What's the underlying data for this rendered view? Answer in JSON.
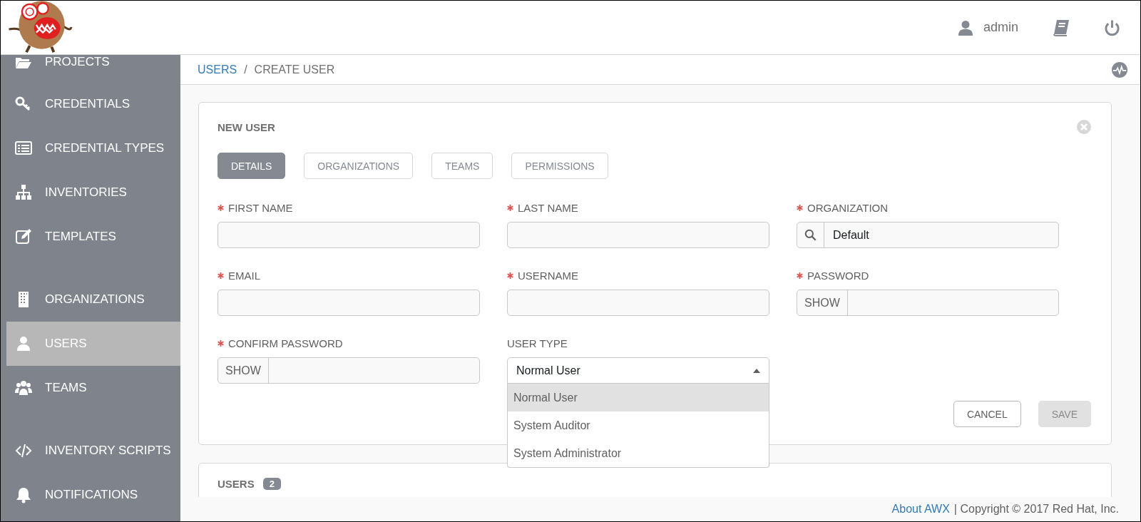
{
  "header": {
    "user": "admin"
  },
  "sidebar": {
    "groups": [
      [
        {
          "label": "PROJECTS",
          "selected": false
        },
        {
          "label": "CREDENTIALS",
          "selected": false
        },
        {
          "label": "CREDENTIAL TYPES",
          "selected": false
        },
        {
          "label": "INVENTORIES",
          "selected": false
        },
        {
          "label": "TEMPLATES",
          "selected": false
        }
      ],
      [
        {
          "label": "ORGANIZATIONS",
          "selected": false
        },
        {
          "label": "USERS",
          "selected": true
        },
        {
          "label": "TEAMS",
          "selected": false
        }
      ],
      [
        {
          "label": "INVENTORY SCRIPTS",
          "selected": false
        },
        {
          "label": "NOTIFICATIONS",
          "selected": false
        }
      ]
    ]
  },
  "breadcrumb": [
    {
      "label": "USERS",
      "link": true
    },
    {
      "label": "/",
      "link": false
    },
    {
      "label": "CREATE USER",
      "link": false
    }
  ],
  "form": {
    "title": "NEW USER",
    "tabs": [
      {
        "label": "DETAILS",
        "selected": true
      },
      {
        "label": "ORGANIZATIONS",
        "selected": false
      },
      {
        "label": "TEAMS",
        "selected": false
      },
      {
        "label": "PERMISSIONS",
        "selected": false
      }
    ],
    "fields": [
      {
        "kind": "text",
        "label": "FIRST NAME",
        "required": true
      },
      {
        "kind": "text",
        "label": "LAST NAME",
        "required": true
      },
      {
        "kind": "lookup",
        "label": "ORGANIZATION",
        "required": true,
        "value": "Default"
      },
      {
        "kind": "text",
        "label": "EMAIL",
        "required": true
      },
      {
        "kind": "text",
        "label": "USERNAME",
        "required": true
      },
      {
        "kind": "password",
        "label": "PASSWORD",
        "required": true,
        "button": "SHOW"
      },
      {
        "kind": "password",
        "label": "CONFIRM PASSWORD",
        "required": true,
        "button": "SHOW"
      },
      {
        "kind": "select",
        "label": "USER TYPE",
        "required": false,
        "value": "Normal User",
        "expanded": true,
        "options": [
          {
            "label": "Normal User",
            "selected": true
          },
          {
            "label": "System Auditor",
            "selected": false
          },
          {
            "label": "System Administrator",
            "selected": false
          }
        ]
      }
    ],
    "buttons": [
      {
        "label": "CANCEL",
        "disabled": false
      },
      {
        "label": "SAVE",
        "disabled": true
      }
    ]
  },
  "users_panel": {
    "title": "USERS",
    "count": "2"
  },
  "footer": {
    "link": "About AWX",
    "text": "| Copyright © 2017 Red Hat, Inc."
  }
}
